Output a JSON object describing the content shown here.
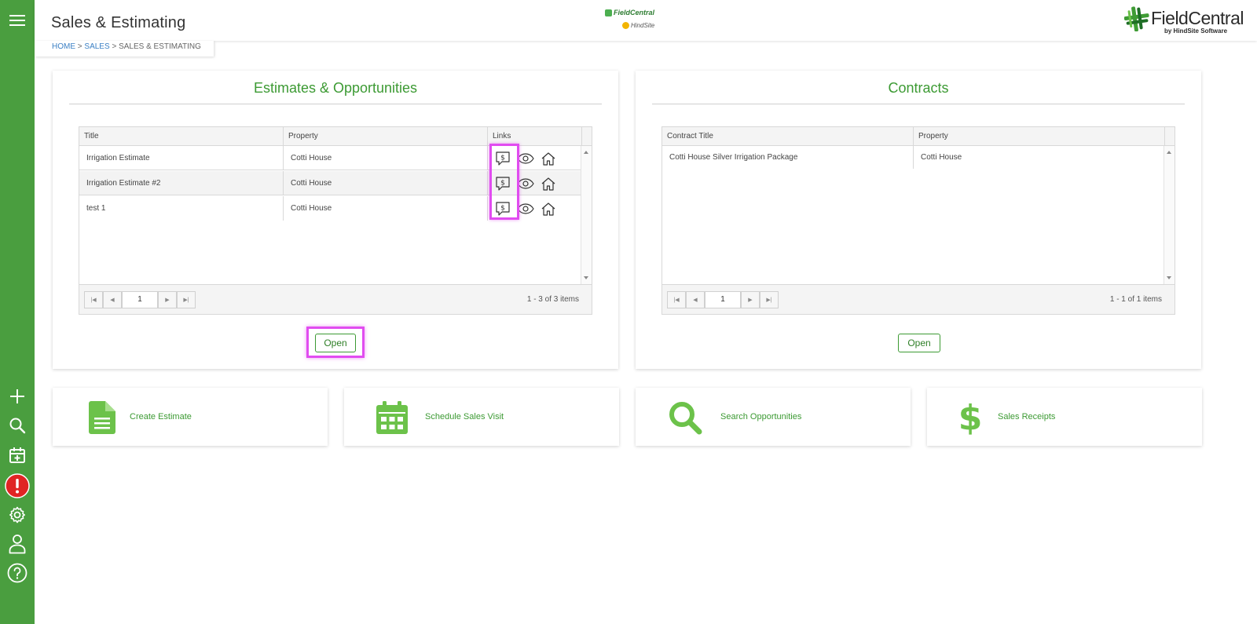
{
  "app": {
    "title": "Sales & Estimating"
  },
  "breadcrumb": {
    "home": "HOME",
    "sep1": ">",
    "sales": "SALES",
    "sep2": ">",
    "current": "SALES & ESTIMATING"
  },
  "header": {
    "center_logo_top": "FieldCentral",
    "center_logo_bottom": "HindSite",
    "brand_name": "FieldCentral",
    "brand_sub": "by HindSite Software"
  },
  "sidebar": {
    "items": [
      {
        "icon": "menu-icon"
      },
      {
        "icon": "add-icon"
      },
      {
        "icon": "search-icon"
      },
      {
        "icon": "calendar-add-icon"
      },
      {
        "icon": "alert-icon",
        "badge_color": "#e02424"
      },
      {
        "icon": "gear-icon"
      },
      {
        "icon": "user-icon"
      },
      {
        "icon": "help-icon"
      }
    ]
  },
  "estimates": {
    "title": "Estimates & Opportunities",
    "columns": [
      "Title",
      "Property",
      "Links"
    ],
    "rows": [
      {
        "title": "Irrigation Estimate",
        "property": "Cotti House"
      },
      {
        "title": "Irrigation Estimate #2",
        "property": "Cotti House"
      },
      {
        "title": "test 1",
        "property": "Cotti House"
      }
    ],
    "link_icons": [
      "estimate-dollar-icon",
      "view-eye-icon",
      "property-home-icon"
    ],
    "pager": {
      "page": "1",
      "info": "1 - 3 of 3 items"
    },
    "open_label": "Open"
  },
  "contracts": {
    "title": "Contracts",
    "columns": [
      "Contract Title",
      "Property"
    ],
    "rows": [
      {
        "title": "Cotti House Silver Irrigation Package",
        "property": "Cotti House"
      }
    ],
    "pager": {
      "page": "1",
      "info": "1 - 1 of 1 items"
    },
    "open_label": "Open"
  },
  "tiles": [
    {
      "label": "Create Estimate",
      "icon": "document-icon"
    },
    {
      "label": "Schedule Sales Visit",
      "icon": "calendar-icon"
    },
    {
      "label": "Search Opportunities",
      "icon": "magnifier-icon"
    },
    {
      "label": "Sales Receipts",
      "icon": "dollar-icon"
    }
  ],
  "colors": {
    "sidebar": "#4a9e3f",
    "accent": "#3c9a33",
    "tile_icon": "#6cc24a",
    "highlight": "#e14cf0",
    "link": "#3a7fc4"
  }
}
